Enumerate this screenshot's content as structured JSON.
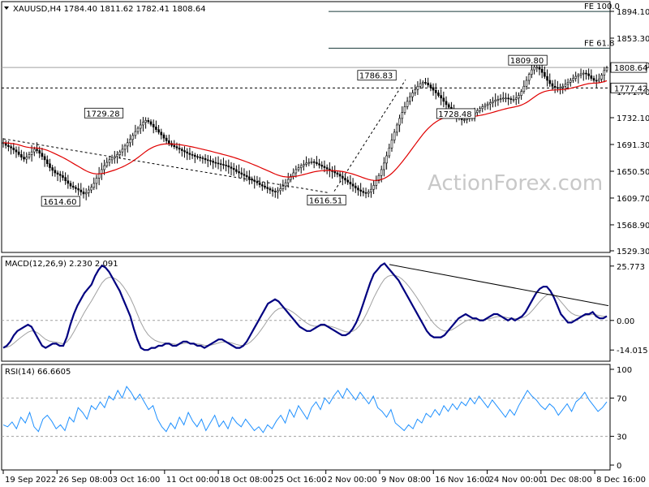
{
  "chart_data": [
    {
      "type": "candlestick",
      "pane": "price",
      "title": "XAUUSD,H4  1784.40 1811.62 1782.41 1808.64",
      "y_ticks": [
        "1894.10",
        "1853.30",
        "1812.50",
        "1771.70",
        "1732.10",
        "1691.30",
        "1650.50",
        "1609.70",
        "1568.90",
        "1529.30"
      ],
      "ylim": [
        1522,
        1902
      ],
      "current_price": "1808.64",
      "ma_value": "1777.42",
      "annotations": [
        {
          "text": "1614.60",
          "x": "2022-09-27",
          "y": 1614.6
        },
        {
          "text": "1729.28",
          "x": "2022-10-03",
          "y": 1729.28
        },
        {
          "text": "1616.51",
          "x": "2022-11-03",
          "y": 1616.51
        },
        {
          "text": "1786.83",
          "x": "2022-11-10",
          "y": 1786.83
        },
        {
          "text": "1728.48",
          "x": "2022-11-21",
          "y": 1728.48
        },
        {
          "text": "1809.80",
          "x": "2022-12-01",
          "y": 1809.8
        }
      ],
      "fib_levels": [
        {
          "text": "FE 100.0",
          "y": 1894.0
        },
        {
          "text": "FE 61.8",
          "y": 1838.0
        }
      ],
      "close_series": [
        1694,
        1690,
        1688,
        1686,
        1683,
        1680,
        1676,
        1672,
        1669,
        1672,
        1676,
        1680,
        1684,
        1682,
        1678,
        1673,
        1668,
        1662,
        1656,
        1652,
        1648,
        1646,
        1644,
        1641,
        1636,
        1632,
        1628,
        1626,
        1624,
        1622,
        1619,
        1616,
        1618,
        1622,
        1626,
        1632,
        1640,
        1647,
        1653,
        1659,
        1664,
        1668,
        1671,
        1673,
        1676,
        1680,
        1684,
        1689,
        1694,
        1699,
        1705,
        1711,
        1716,
        1721,
        1725,
        1728,
        1726,
        1722,
        1718,
        1714,
        1710,
        1706,
        1701,
        1697,
        1693,
        1690,
        1688,
        1686,
        1684,
        1682,
        1680,
        1678,
        1676,
        1675,
        1673,
        1672,
        1671,
        1670,
        1668,
        1667,
        1666,
        1664,
        1663,
        1662,
        1661,
        1660,
        1659,
        1657,
        1655,
        1653,
        1650,
        1648,
        1646,
        1644,
        1642,
        1639,
        1637,
        1635,
        1633,
        1630,
        1628,
        1626,
        1624,
        1622,
        1620,
        1619,
        1621,
        1624,
        1628,
        1633,
        1638,
        1643,
        1648,
        1653,
        1656,
        1659,
        1661,
        1663,
        1664,
        1665,
        1664,
        1662,
        1660,
        1658,
        1656,
        1654,
        1652,
        1650,
        1648,
        1646,
        1643,
        1640,
        1637,
        1634,
        1631,
        1628,
        1625,
        1622,
        1620,
        1618,
        1617,
        1619,
        1623,
        1629,
        1636,
        1644,
        1653,
        1663,
        1674,
        1686,
        1698,
        1710,
        1721,
        1731,
        1740,
        1749,
        1757,
        1764,
        1770,
        1775,
        1780,
        1784,
        1786,
        1785,
        1782,
        1778,
        1774,
        1770,
        1766,
        1762,
        1757,
        1752,
        1748,
        1744,
        1740,
        1736,
        1732,
        1729,
        1729,
        1731,
        1734,
        1737,
        1740,
        1743,
        1746,
        1749,
        1751,
        1753,
        1755,
        1757,
        1759,
        1760,
        1761,
        1762,
        1762,
        1761,
        1760,
        1760,
        1762,
        1766,
        1772,
        1780,
        1789,
        1798,
        1805,
        1809,
        1809,
        1806,
        1801,
        1795,
        1789,
        1784,
        1780,
        1778,
        1777,
        1778,
        1780,
        1783,
        1786,
        1789,
        1792,
        1795,
        1797,
        1799,
        1800,
        1799,
        1796,
        1792,
        1789,
        1788,
        1791,
        1797,
        1804,
        1808
      ],
      "xlabels": [
        "19 Sep 2022",
        "26 Sep 08:00",
        "3 Oct 16:00",
        "11 Oct 00:00",
        "18 Oct 08:00",
        "25 Oct 16:00",
        "2 Nov 00:00",
        "9 Nov 08:00",
        "16 Nov 16:00",
        "24 Nov 00:00",
        "1 Dec 08:00",
        "8 Dec 16:00"
      ]
    },
    {
      "type": "line",
      "pane": "macd",
      "title": "MACD(12,26,9) 2.230 2.091",
      "y_ticks": [
        "25.773",
        "0.00",
        "-14.015"
      ],
      "ylim": [
        -17,
        28
      ],
      "series": [
        {
          "name": "MACD",
          "values": [
            -13,
            -12,
            -10,
            -7,
            -5,
            -4,
            -3,
            -2,
            -3,
            -6,
            -9,
            -12,
            -13,
            -12,
            -11,
            -11,
            -12,
            -12,
            -8,
            -2,
            3,
            7,
            10,
            13,
            15,
            17,
            21,
            24,
            26,
            25,
            23,
            20,
            17,
            14,
            10,
            6,
            2,
            -4,
            -9,
            -13,
            -14,
            -14,
            -13,
            -13,
            -12,
            -12,
            -11,
            -11,
            -12,
            -12,
            -11,
            -10,
            -10,
            -11,
            -11,
            -12,
            -12,
            -13,
            -12,
            -11,
            -10,
            -9,
            -9,
            -10,
            -11,
            -12,
            -13,
            -13,
            -12,
            -10,
            -7,
            -4,
            -1,
            2,
            5,
            8,
            9,
            10,
            9,
            7,
            5,
            3,
            1,
            -1,
            -3,
            -4,
            -5,
            -5,
            -4,
            -3,
            -2,
            -2,
            -3,
            -4,
            -5,
            -6,
            -7,
            -7,
            -6,
            -4,
            -1,
            3,
            8,
            13,
            18,
            22,
            24,
            26,
            27,
            25,
            23,
            21,
            19,
            16,
            13,
            10,
            7,
            4,
            1,
            -2,
            -5,
            -7,
            -8,
            -8,
            -8,
            -7,
            -5,
            -3,
            -1,
            1,
            2,
            3,
            2,
            1,
            1,
            0,
            0,
            1,
            2,
            3,
            3,
            2,
            1,
            0,
            1,
            0,
            1,
            2,
            4,
            7,
            10,
            13,
            15,
            16,
            16,
            14,
            11,
            7,
            3,
            1,
            -1,
            -1,
            0,
            1,
            2,
            3,
            3,
            4,
            2,
            1,
            1,
            2
          ]
        }
      ]
    },
    {
      "type": "line",
      "pane": "rsi",
      "title": "RSI(14) 66.6605",
      "y_ticks": [
        "100",
        "70",
        "30",
        "0"
      ],
      "ylim": [
        0,
        100
      ],
      "series": [
        {
          "name": "RSI",
          "values": [
            42,
            40,
            45,
            38,
            50,
            44,
            55,
            40,
            35,
            48,
            52,
            46,
            38,
            42,
            36,
            50,
            45,
            60,
            55,
            48,
            62,
            58,
            66,
            60,
            72,
            68,
            78,
            70,
            82,
            76,
            68,
            74,
            66,
            58,
            62,
            48,
            40,
            35,
            44,
            38,
            50,
            42,
            55,
            46,
            40,
            48,
            36,
            44,
            52,
            40,
            46,
            38,
            50,
            44,
            40,
            48,
            42,
            36,
            40,
            34,
            42,
            38,
            46,
            52,
            44,
            58,
            50,
            62,
            55,
            48,
            60,
            66,
            58,
            70,
            64,
            72,
            78,
            70,
            80,
            74,
            68,
            76,
            70,
            64,
            72,
            60,
            56,
            50,
            58,
            44,
            40,
            36,
            42,
            38,
            48,
            44,
            54,
            50,
            58,
            52,
            62,
            56,
            64,
            58,
            66,
            62,
            70,
            64,
            72,
            66,
            60,
            68,
            62,
            56,
            50,
            58,
            52,
            62,
            70,
            78,
            72,
            68,
            62,
            58,
            64,
            60,
            52,
            58,
            64,
            56,
            66,
            70,
            76,
            68,
            62,
            56,
            60,
            66
          ]
        }
      ]
    }
  ],
  "watermark": "ActionForex.com"
}
